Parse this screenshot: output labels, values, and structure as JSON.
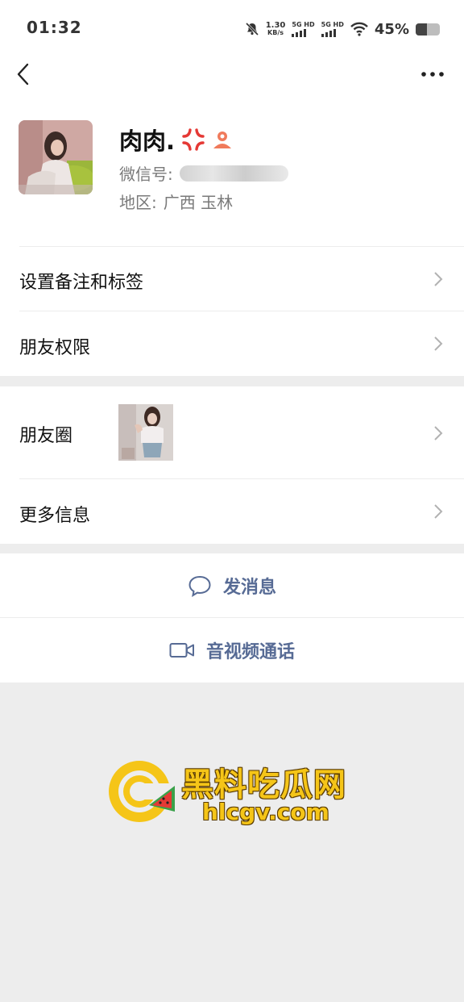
{
  "status_bar": {
    "time": "01:32",
    "net_speed_value": "1.30",
    "net_speed_unit": "KB/s",
    "sim1": "5G HD",
    "sim2": "5G HD",
    "battery_percent": "45%",
    "battery_level": 0.45
  },
  "nav": {
    "back_icon": "chevron-left-icon",
    "more_icon": "more-dots-icon"
  },
  "profile": {
    "nickname": "肉肉.",
    "wechat_id_label": "微信号:",
    "region_label": "地区:",
    "region_value": "广西  玉林"
  },
  "menu": {
    "set_remark": "设置备注和标签",
    "friend_permissions": "朋友权限",
    "moments": "朋友圈",
    "more_info": "更多信息"
  },
  "actions": {
    "send_message": "发消息",
    "video_call": "音视频通话"
  },
  "watermark": {
    "title": "黑料吃瓜网",
    "url": "hlcgv.com"
  },
  "colors": {
    "link_blue": "#576b95",
    "page_gray": "#ededed",
    "watermark_yellow": "#f5c518"
  }
}
